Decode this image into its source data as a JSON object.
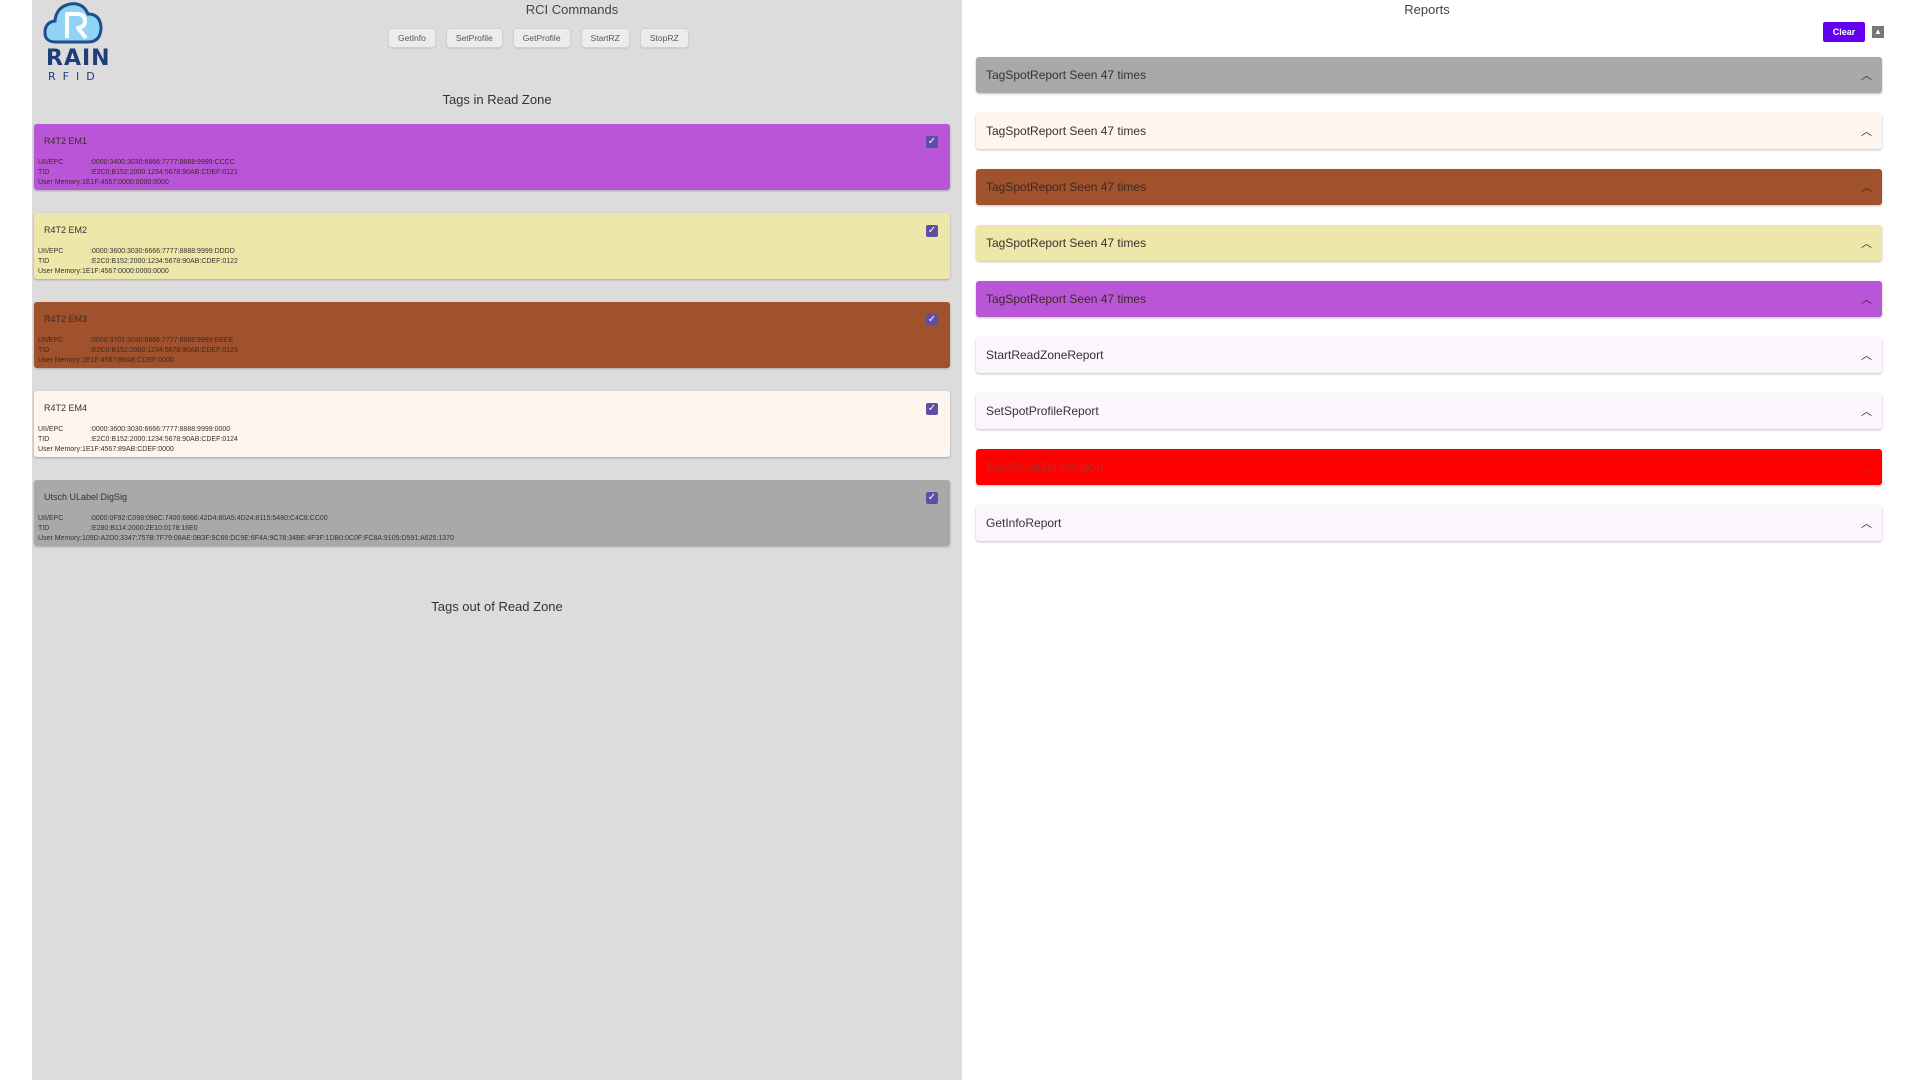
{
  "logo": {
    "rain": "RAIN",
    "rfid": "RFID"
  },
  "commands": {
    "title": "RCI Commands",
    "buttons": [
      "GetInfo",
      "SetProfile",
      "GetProfile",
      "StartRZ",
      "StopRZ"
    ]
  },
  "tags_in": {
    "title": "Tags in Read Zone",
    "items": [
      {
        "name": "R4T2 EM1",
        "epc_label": "UII/EPC",
        "epc": ":0000:3400:3030:6666:7777:8888:9999:CCCC",
        "tid_label": "TID",
        "tid": ":E2C0:B152:2000:1234:5678:90AB:CDEF:0121",
        "mem_label": "User Memory",
        "mem": ":1E1F:4567:0000:0000:0000",
        "color": "#b956d7"
      },
      {
        "name": "R4T2 EM2",
        "epc_label": "UII/EPC",
        "epc": ":0000:3600:3030:6666:7777:8888:9999:DDDD",
        "tid_label": "TID",
        "tid": ":E2C0:B152:2000:1234:5678:90AB:CDEF:0122",
        "mem_label": "User Memory",
        "mem": ":1E1F:4567:0000:0000:0000",
        "color": "#eee7aa"
      },
      {
        "name": "R4T2 EM3",
        "epc_label": "UII/EPC",
        "epc": ":0000:3701:3030:6666:7777:8888:9999:EEEE",
        "tid_label": "TID",
        "tid": ":E2C0:B152:2000:1234:5678:90AB:CDEF:0123",
        "mem_label": "User Memory",
        "mem": ":1E1F:4567:89AB:CDEF:0000",
        "color": "#a0522d"
      },
      {
        "name": "R4T2 EM4",
        "epc_label": "UII/EPC",
        "epc": ":0000:3600:3030:6666:7777:8888:9999:0000",
        "tid_label": "TID",
        "tid": ":E2C0:B152:2000:1234:5678:90AB:CDEF:0124",
        "mem_label": "User Memory",
        "mem": ":1E1F:4567:89AB:CDEF:0000",
        "color": "#fdf5ee"
      },
      {
        "name": "Utsch ULabel DigSig",
        "epc_label": "UII/EPC",
        "epc": ":0000:0F92:C098:098C:7400:6866:42D4:80A5:4D24:8115:5480:C4C8:CC00",
        "tid_label": "TID",
        "tid": ":E280:B114:2000:2E10:0178:16E0",
        "mem_label": "User Memory",
        "mem": ":109D:A2D0:3347:757B:7F79:08AE:0B3F:9C66:DC9E:6F4A:9C78:34BE:4F3F:1DB0:0C0F:FC8A:9105:D591:A625:1370",
        "color": "#a9a9a9"
      }
    ]
  },
  "tags_out": {
    "title": "Tags out of Read Zone"
  },
  "reports": {
    "title": "Reports",
    "clear_label": "Clear",
    "items": [
      {
        "label": "TagSpotReport Seen 47 times",
        "color": "#a9a9a9"
      },
      {
        "label": "TagSpotReport Seen 47 times",
        "color": "#fdf5ee"
      },
      {
        "label": "TagSpotReport Seen 47 times",
        "color": "#a0522d"
      },
      {
        "label": "TagSpotReport Seen 47 times",
        "color": "#eee7aa"
      },
      {
        "label": "TagSpotReport Seen 47 times",
        "color": "#b956d7"
      },
      {
        "label": "StartReadZoneReport",
        "color": "#fcf5fd"
      },
      {
        "label": "SetSpotProfileReport",
        "color": "#fcf5fd"
      },
      {
        "label": "StartReadZoneReport",
        "color": "#ff0000"
      },
      {
        "label": "GetInfoReport",
        "color": "#fcf5fd"
      }
    ]
  }
}
